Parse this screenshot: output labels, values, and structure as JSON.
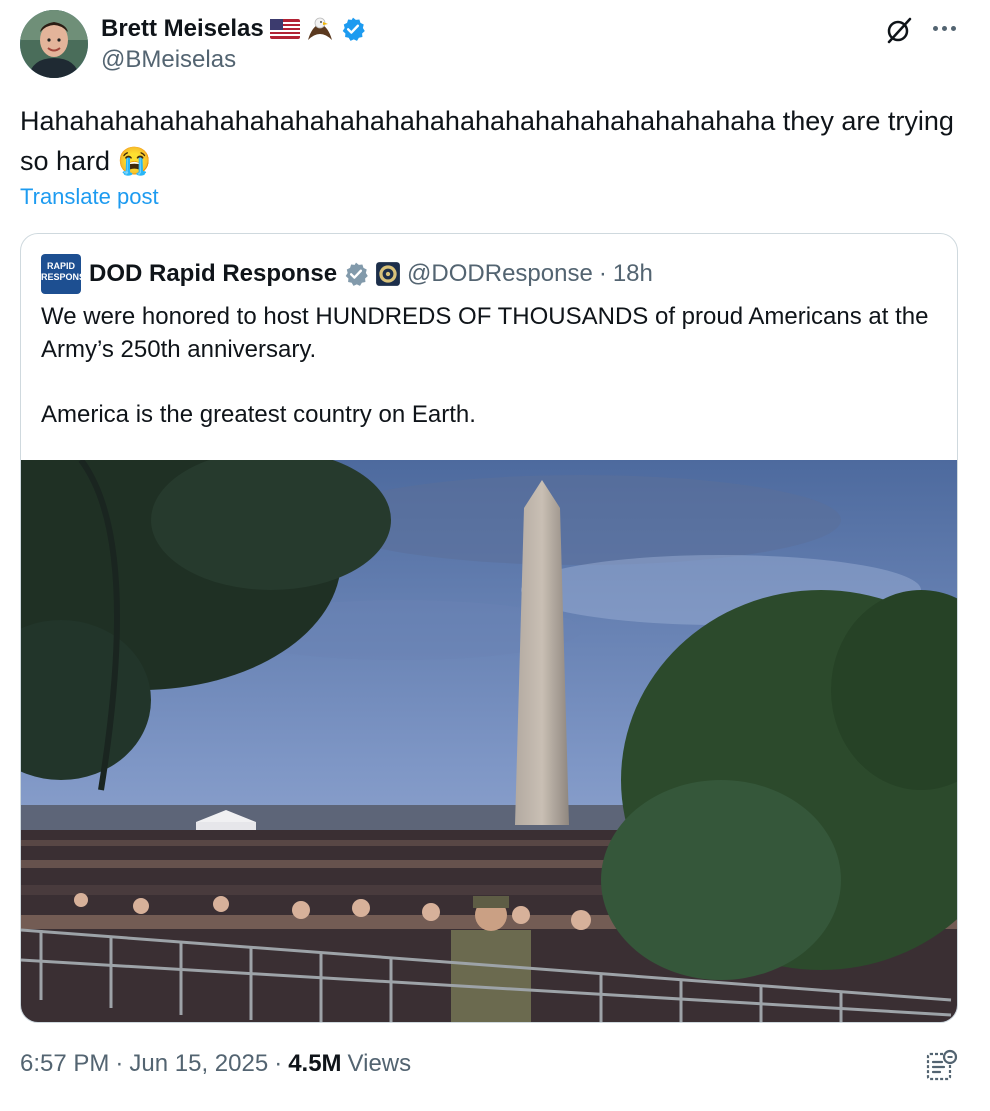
{
  "author": {
    "name": "Brett Meiselas",
    "handle": "@BMeiselas",
    "flag_emoji": "🇺🇸",
    "eagle_emoji": "🦅"
  },
  "post": {
    "text": "Hahahahahahahahahahahahahahahahahahahahahahahahaha they are trying so hard 😭",
    "translate_label": "Translate post"
  },
  "quoted": {
    "name": "DOD Rapid Response",
    "avatar_text": "RAPID RESPONSE",
    "handle": "@DODResponse",
    "separator": "·",
    "time": "18h",
    "paragraph1": "We were honored to host HUNDREDS OF THOUSANDS of proud Americans at the Army’s 250th anniversary.",
    "paragraph2": "America is the greatest country on Earth."
  },
  "meta": {
    "time": "6:57 PM",
    "sep1": "·",
    "date": "Jun 15, 2025",
    "sep2": "·",
    "views_count": "4.5M",
    "views_label": "Views"
  },
  "colors": {
    "link": "#1d9bf0",
    "verified": "#1d9bf0",
    "muted": "#536471",
    "gov_badge": "#829aab"
  },
  "icons": {
    "verified": "verified-badge-icon",
    "grok": "grok-icon",
    "more": "more-icon",
    "analytics": "analytics-icon"
  }
}
